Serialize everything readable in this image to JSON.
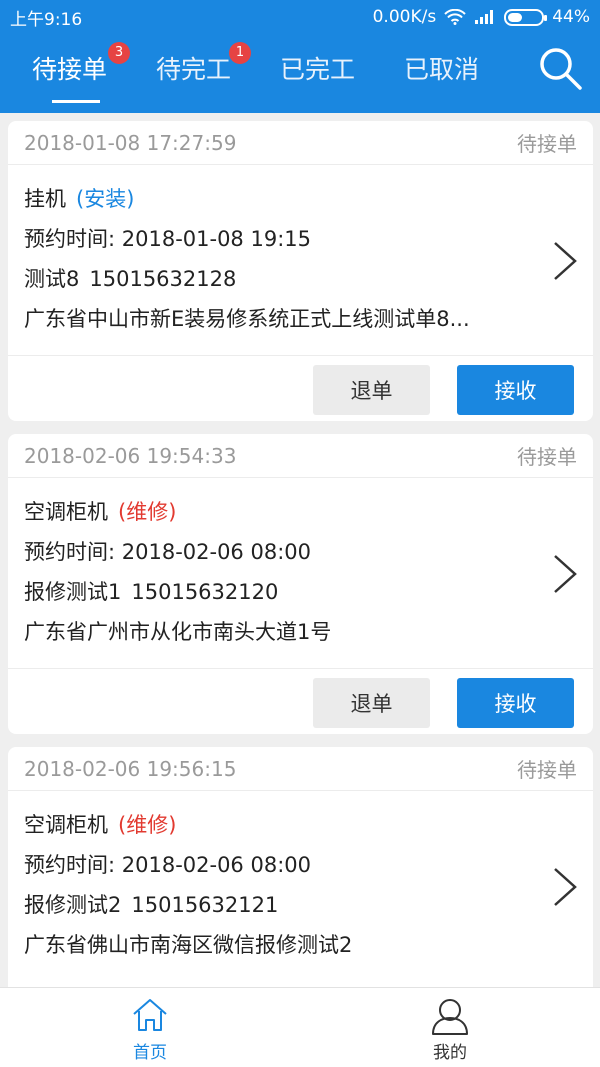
{
  "status_bar": {
    "time": "上午9:16",
    "network_speed": "0.00K/s",
    "battery": "44%",
    "battery_level": 0.44,
    "icons": [
      "wifi-icon",
      "signal-icon",
      "battery-icon"
    ]
  },
  "tabs": [
    {
      "label": "待接单",
      "badge": "3",
      "active": true
    },
    {
      "label": "待完工",
      "badge": "1",
      "active": false
    },
    {
      "label": "已完工",
      "badge": "",
      "active": false
    },
    {
      "label": "已取消",
      "badge": "",
      "active": false
    }
  ],
  "colors": {
    "primary": "#1a87e0",
    "badge": "#e64343",
    "install": "#1a87e0",
    "repair": "#e23a30"
  },
  "orders": [
    {
      "datetime": "2018-01-08 17:27:59",
      "status": "待接单",
      "device": "挂机",
      "service_type": "(安装)",
      "appointment": "预约时间: 2018-01-08 19:15",
      "customer": "测试8",
      "phone": "15015632128",
      "address": "广东省中山市新E装易修系统正式上线测试单8..."
    },
    {
      "datetime": "2018-02-06 19:54:33",
      "status": "待接单",
      "device": "空调柜机",
      "service_type": "(维修)",
      "appointment": "预约时间: 2018-02-06 08:00",
      "customer": "报修测试1",
      "phone": "15015632120",
      "address": "广东省广州市从化市南头大道1号"
    },
    {
      "datetime": "2018-02-06 19:56:15",
      "status": "待接单",
      "device": "空调柜机",
      "service_type": "(维修)",
      "appointment": "预约时间: 2018-02-06 08:00",
      "customer": "报修测试2",
      "phone": "15015632121",
      "address": "广东省佛山市南海区微信报修测试2"
    }
  ],
  "actions": {
    "reject_label": "退单",
    "accept_label": "接收"
  },
  "bottom_nav": {
    "home": "首页",
    "mine": "我的"
  }
}
